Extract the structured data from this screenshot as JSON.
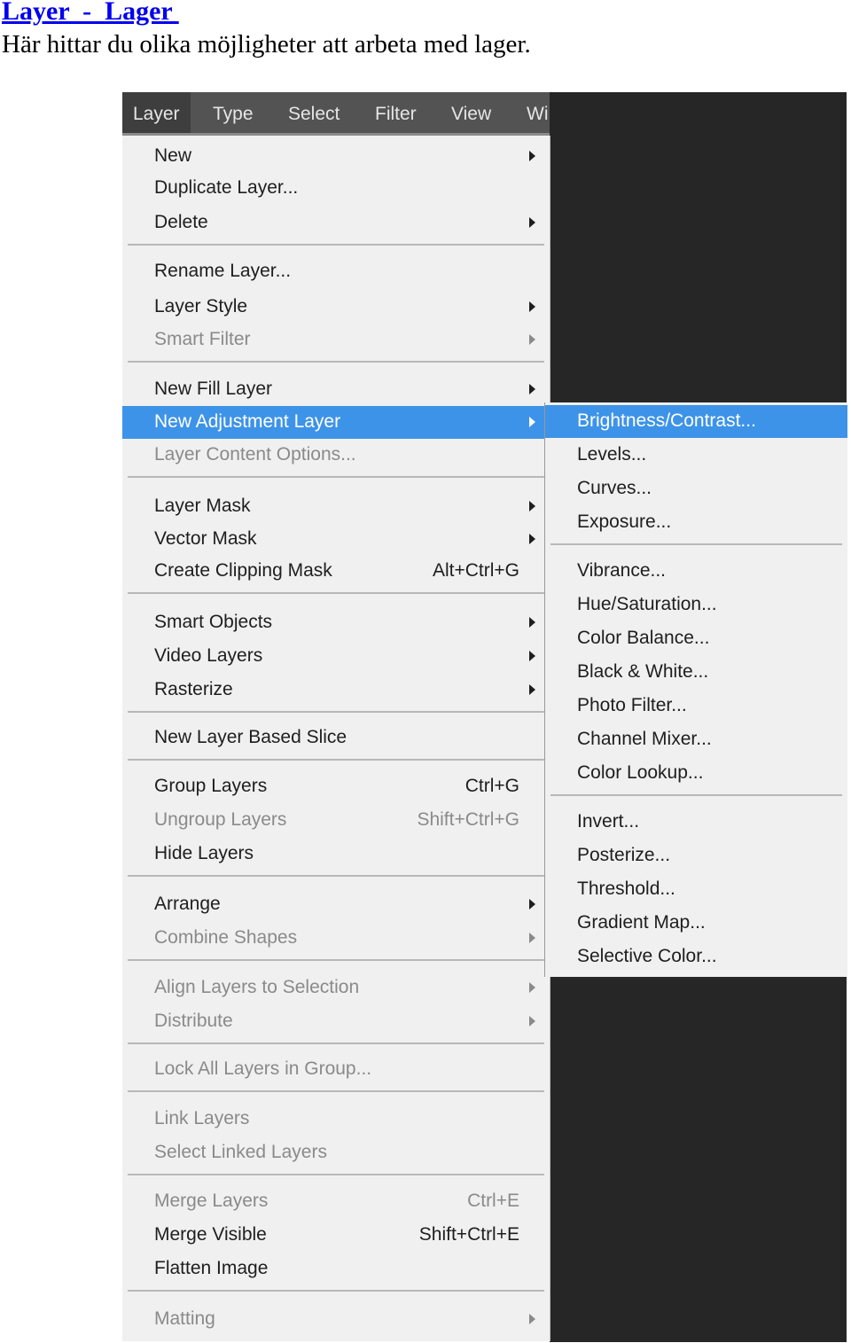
{
  "document": {
    "title": "Layer  -  Lager ",
    "intro": "Här hittar du olika möjligheter att arbeta med lager."
  },
  "menubar": [
    "Layer",
    "Type",
    "Select",
    "Filter",
    "View",
    "Wi"
  ],
  "colors": {
    "highlight": "#3d93e8",
    "menu_bg": "#f0f0f0",
    "menubar_bg": "#535353",
    "workspace": "#262626"
  },
  "layer_menu": [
    {
      "label": "New",
      "submenu": true
    },
    {
      "label": "Duplicate Layer..."
    },
    {
      "label": "Delete",
      "submenu": true,
      "sep": true
    },
    {
      "label": "Rename Layer..."
    },
    {
      "label": "Layer Style",
      "submenu": true
    },
    {
      "label": "Smart Filter",
      "submenu": true,
      "disabled": true,
      "sep": true
    },
    {
      "label": "New Fill Layer",
      "submenu": true
    },
    {
      "label": "New Adjustment Layer",
      "submenu": true,
      "highlighted": true
    },
    {
      "label": "Layer Content Options...",
      "disabled": true,
      "sep": true
    },
    {
      "label": "Layer Mask",
      "submenu": true
    },
    {
      "label": "Vector Mask",
      "submenu": true
    },
    {
      "label": "Create Clipping Mask",
      "shortcut": "Alt+Ctrl+G",
      "sep": true
    },
    {
      "label": "Smart Objects",
      "submenu": true
    },
    {
      "label": "Video Layers",
      "submenu": true
    },
    {
      "label": "Rasterize",
      "submenu": true,
      "sep": true
    },
    {
      "label": "New Layer Based Slice",
      "sep": true
    },
    {
      "label": "Group Layers",
      "shortcut": "Ctrl+G"
    },
    {
      "label": "Ungroup Layers",
      "shortcut": "Shift+Ctrl+G",
      "disabled": true
    },
    {
      "label": "Hide Layers",
      "sep": true
    },
    {
      "label": "Arrange",
      "submenu": true
    },
    {
      "label": "Combine Shapes",
      "submenu": true,
      "disabled": true,
      "sep": true
    },
    {
      "label": "Align Layers to Selection",
      "submenu": true,
      "disabled": true
    },
    {
      "label": "Distribute",
      "submenu": true,
      "disabled": true,
      "sep": true
    },
    {
      "label": "Lock All Layers in Group...",
      "disabled": true,
      "sep": true
    },
    {
      "label": "Link Layers",
      "disabled": true
    },
    {
      "label": "Select Linked Layers",
      "disabled": true,
      "sep": true
    },
    {
      "label": "Merge Layers",
      "shortcut": "Ctrl+E",
      "disabled": true
    },
    {
      "label": "Merge Visible",
      "shortcut": "Shift+Ctrl+E"
    },
    {
      "label": "Flatten Image",
      "sep": true
    },
    {
      "label": "Matting",
      "submenu": true,
      "disabled": true
    }
  ],
  "adjustment_submenu": [
    {
      "label": "Brightness/Contrast...",
      "highlighted": true
    },
    {
      "label": "Levels..."
    },
    {
      "label": "Curves..."
    },
    {
      "label": "Exposure...",
      "sep": true
    },
    {
      "label": "Vibrance..."
    },
    {
      "label": "Hue/Saturation..."
    },
    {
      "label": "Color Balance..."
    },
    {
      "label": "Black & White..."
    },
    {
      "label": "Photo Filter..."
    },
    {
      "label": "Channel Mixer..."
    },
    {
      "label": "Color Lookup...",
      "sep": true
    },
    {
      "label": "Invert..."
    },
    {
      "label": "Posterize..."
    },
    {
      "label": "Threshold..."
    },
    {
      "label": "Gradient Map..."
    },
    {
      "label": "Selective Color..."
    }
  ]
}
